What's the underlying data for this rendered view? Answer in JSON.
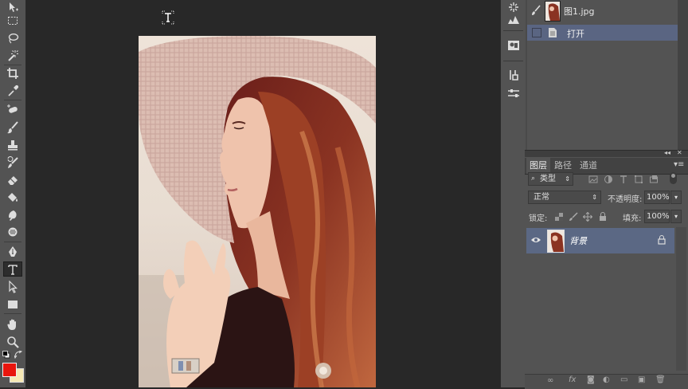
{
  "history_panel": {
    "snapshot_label": "图1.jpg",
    "step_label": "打开"
  },
  "layers_panel": {
    "tabs": [
      {
        "label": "图层",
        "active": true
      },
      {
        "label": "路径",
        "active": false
      },
      {
        "label": "通道",
        "active": false
      }
    ],
    "filter_kind": "类型",
    "blend_mode": "正常",
    "opacity_label": "不透明度:",
    "opacity_value": "100%",
    "lock_label": "锁定:",
    "fill_label": "填充:",
    "fill_value": "100%",
    "layers": [
      {
        "name": "背景",
        "visible": true,
        "locked": true,
        "selected": true
      }
    ]
  },
  "colors": {
    "foreground": "#e8150d",
    "background": "#f5e8b4",
    "selection": "#5b6884",
    "history_selection": "#5a6582"
  },
  "tools": [
    "move-icon",
    "marquee-icon",
    "lasso-icon",
    "magic-wand-icon",
    "crop-icon",
    "eyedropper-icon",
    "spot-heal-icon",
    "brush-icon",
    "stamp-icon",
    "history-brush-icon",
    "eraser-icon",
    "bucket-icon",
    "blur-icon",
    "dodge-icon",
    "pen-icon",
    "type-icon",
    "path-select-icon",
    "rectangle-icon",
    "hand-icon",
    "zoom-icon"
  ],
  "active_tool": "type-icon"
}
